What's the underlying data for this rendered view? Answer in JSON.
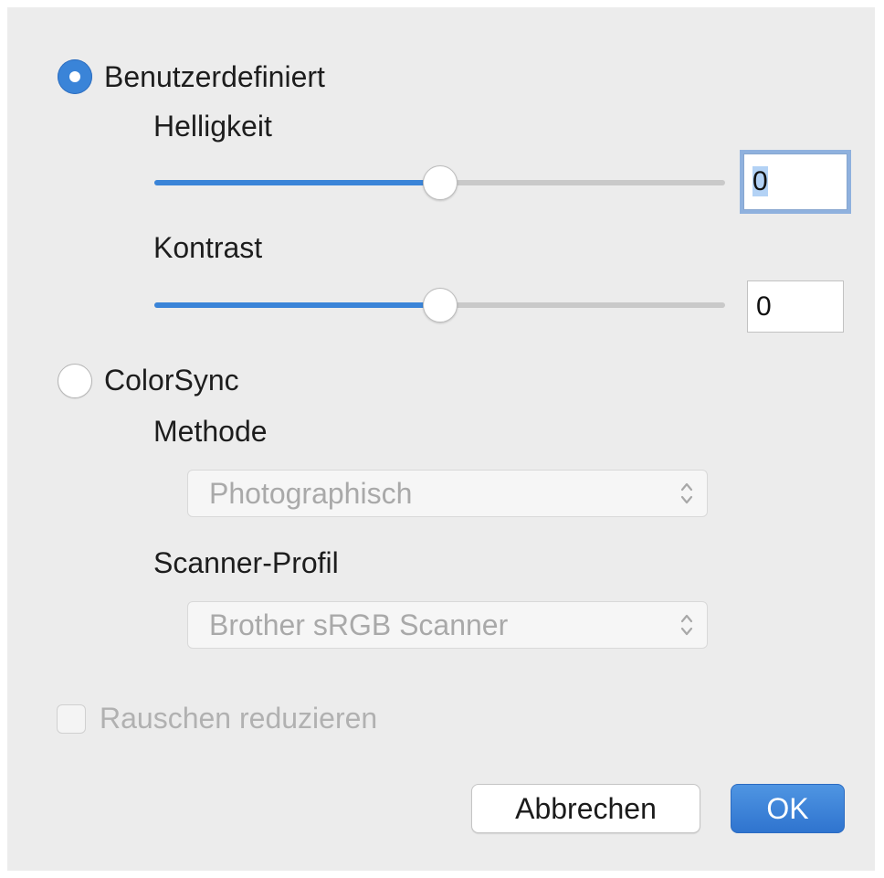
{
  "mode": {
    "custom": {
      "label": "Benutzerdefiniert",
      "selected": true,
      "brightness": {
        "label": "Helligkeit",
        "value": "0",
        "slider_fraction": 0.5
      },
      "contrast": {
        "label": "Kontrast",
        "value": "0",
        "slider_fraction": 0.5
      }
    },
    "colorsync": {
      "label": "ColorSync",
      "selected": false,
      "method": {
        "label": "Methode",
        "selected": "Photographisch"
      },
      "scanner_profile": {
        "label": "Scanner-Profil",
        "selected": "Brother sRGB Scanner"
      }
    }
  },
  "noise_reduction": {
    "label": "Rauschen reduzieren",
    "checked": false,
    "enabled": false
  },
  "buttons": {
    "cancel": "Abbrechen",
    "ok": "OK"
  },
  "colors": {
    "accent": "#3a84d8",
    "primary_button": "#2f74cf",
    "panel_background": "#ececec",
    "disabled_text": "#b1b1b1"
  },
  "icons": {
    "popup_indicator": "chevron-up-down-icon"
  }
}
